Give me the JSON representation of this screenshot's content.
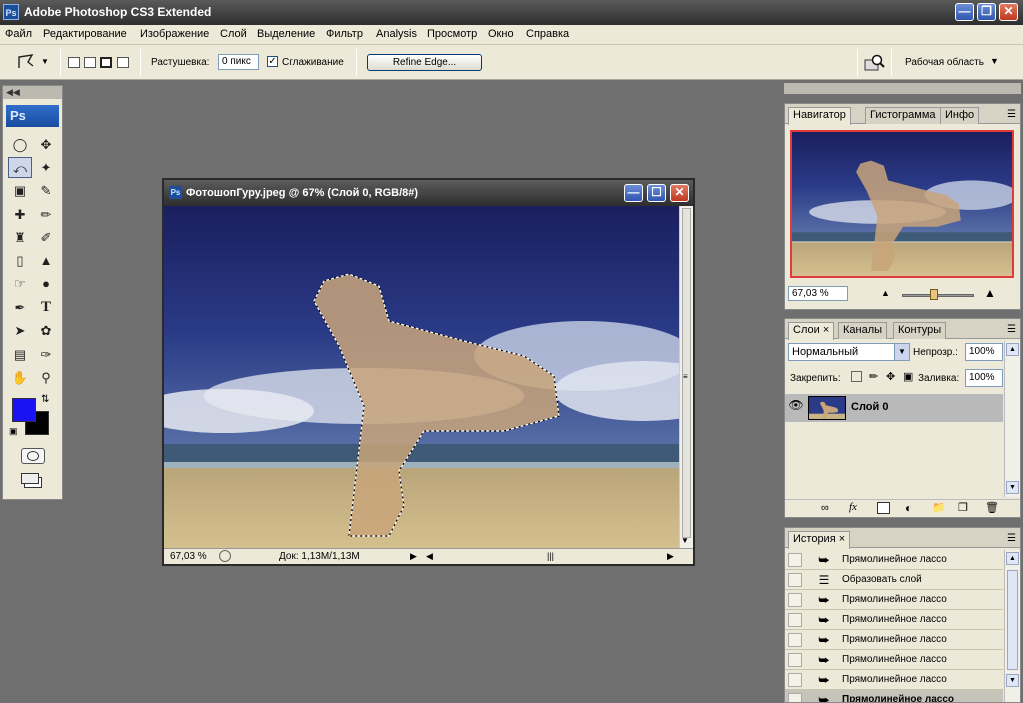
{
  "app": {
    "title": "Adobe Photoshop CS3 Extended",
    "logo_text": "Ps"
  },
  "menu": [
    "Файл",
    "Редактирование",
    "Изображение",
    "Слой",
    "Выделение",
    "Фильтр",
    "Analysis",
    "Просмотр",
    "Окно",
    "Справка"
  ],
  "options": {
    "feather_label": "Растушевка:",
    "feather_value": "0 пикс",
    "antialias_label": "Сглаживание",
    "antialias_checked": true,
    "refine_edge": "Refine Edge...",
    "workspace": "Рабочая область"
  },
  "toolbox": {
    "logo": "Ps",
    "foreground_color": "#1a12f2",
    "background_color": "#000000"
  },
  "document": {
    "title": "ФотошопГуру.jpeg @ 67% (Слой 0, RGB/8#)",
    "zoom": "67,03 %",
    "doc_info": "Док: 1,13M/1,13M"
  },
  "navigator": {
    "tabs": [
      "Навигатор",
      "Гистограмма",
      "Инфо"
    ],
    "zoom": "67,03 %",
    "slider_value": 0.45
  },
  "layers": {
    "tabs": [
      "Слои",
      "Каналы",
      "Контуры"
    ],
    "blend_mode": "Нормальный",
    "opacity_label": "Непрозр.:",
    "opacity_value": "100%",
    "lock_label": "Закрепить:",
    "fill_label": "Заливка:",
    "fill_value": "100%",
    "layer_name": "Слой 0"
  },
  "history": {
    "tab": "История",
    "items": [
      {
        "label": "Прямолинейное лассо",
        "icon": "polygonal-lasso"
      },
      {
        "label": "Образовать слой",
        "icon": "new-layer"
      },
      {
        "label": "Прямолинейное лассо",
        "icon": "polygonal-lasso"
      },
      {
        "label": "Прямолинейное лассо",
        "icon": "polygonal-lasso"
      },
      {
        "label": "Прямолинейное лассо",
        "icon": "polygonal-lasso"
      },
      {
        "label": "Прямолинейное лассо",
        "icon": "polygonal-lasso"
      },
      {
        "label": "Прямолинейное лассо",
        "icon": "polygonal-lasso"
      },
      {
        "label": "Прямолинейное лассо",
        "icon": "polygonal-lasso",
        "selected": true
      }
    ]
  }
}
